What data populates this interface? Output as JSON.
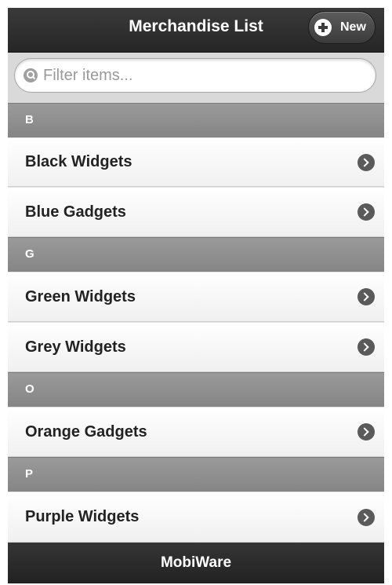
{
  "header": {
    "title": "Merchandise List",
    "new_button": {
      "label": "New",
      "icon": "plus-icon"
    }
  },
  "search": {
    "placeholder": "Filter items...",
    "value": "",
    "icon": "search-icon"
  },
  "sections": [
    {
      "letter": "B",
      "items": [
        "Black Widgets",
        "Blue Gadgets"
      ]
    },
    {
      "letter": "G",
      "items": [
        "Green Widgets",
        "Grey Widgets"
      ]
    },
    {
      "letter": "O",
      "items": [
        "Orange Gadgets"
      ]
    },
    {
      "letter": "P",
      "items": [
        "Purple Widgets"
      ]
    }
  ],
  "row_icon": "chevron-right-icon",
  "footer": {
    "title": "MobiWare"
  },
  "colors": {
    "header_bar": "#2e2e2e",
    "divider": "#8f8f8f",
    "row": "#f6f6f6",
    "footer_bar": "#2a2a2a"
  }
}
